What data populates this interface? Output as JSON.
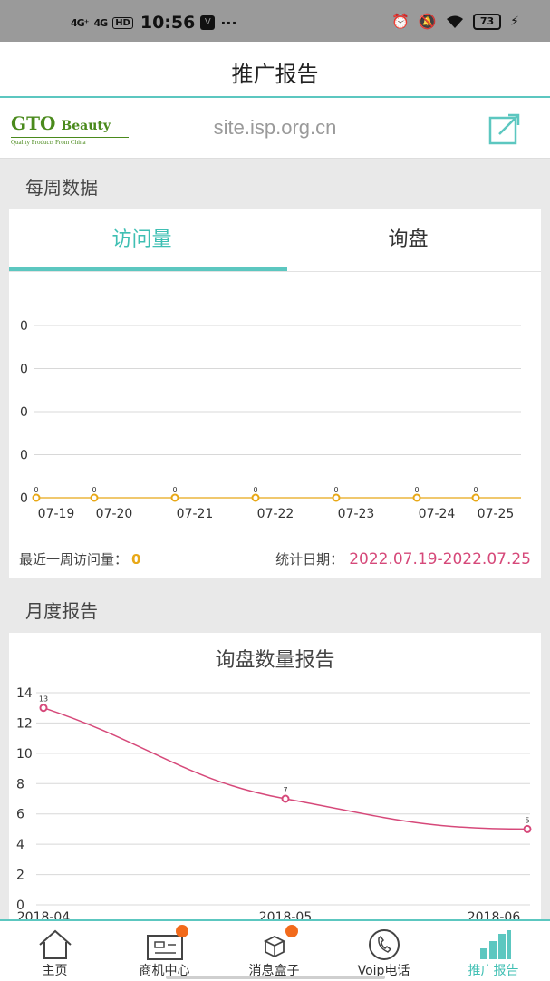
{
  "status_bar": {
    "signal1": "4G⁺",
    "signal2": "4G",
    "hd": "HD",
    "time": "10:56",
    "dots": "···",
    "battery": "73"
  },
  "header": {
    "title": "推广报告"
  },
  "site": {
    "logo_main": "GTO",
    "logo_brand": "Beauty",
    "logo_tagline": "Quality Products From China",
    "url": "site.isp.org.cn"
  },
  "weekly": {
    "section_title": "每周数据",
    "tabs": [
      {
        "label": "访问量",
        "active": true
      },
      {
        "label": "询盘",
        "active": false
      }
    ],
    "total_label": "最近一周访问量：",
    "total_value": "0",
    "date_label": "统计日期：",
    "date_range": "2022.07.19-2022.07.25"
  },
  "monthly": {
    "section_title": "月度报告",
    "chart_title": "询盘数量报告"
  },
  "chart_data": [
    {
      "type": "line",
      "title": "",
      "categories": [
        "07-19",
        "07-20",
        "07-21",
        "07-22",
        "07-23",
        "07-24",
        "07-25"
      ],
      "series": [
        {
          "values": [
            0,
            0,
            0,
            0,
            0,
            0,
            0
          ]
        }
      ],
      "y_ticks": [
        "0",
        "0",
        "0",
        "0",
        "0"
      ],
      "grid": true,
      "color": "#e8a817"
    },
    {
      "type": "line",
      "title": "询盘数量报告",
      "categories": [
        "2018-04",
        "2018-05",
        "2018-06"
      ],
      "series": [
        {
          "values": [
            13,
            7,
            5
          ]
        }
      ],
      "ylim": [
        0,
        14
      ],
      "y_ticks": [
        "0",
        "2",
        "4",
        "6",
        "8",
        "10",
        "12",
        "14"
      ],
      "grid": true,
      "color": "#d6497a"
    }
  ],
  "bottom_nav": [
    {
      "label": "主页",
      "icon": "home-icon",
      "active": false
    },
    {
      "label": "商机中心",
      "icon": "business-card-icon",
      "active": false,
      "badge": true
    },
    {
      "label": "消息盒子",
      "icon": "message-box-icon",
      "active": false,
      "badge": true
    },
    {
      "label": "Voip电话",
      "icon": "phone-icon",
      "active": false
    },
    {
      "label": "推广报告",
      "icon": "report-chart-icon",
      "active": true
    }
  ],
  "colors": {
    "accent": "#3fbfb3",
    "weekly_line": "#e8a817",
    "monthly_line": "#d6497a",
    "badge": "#f26a1b"
  }
}
